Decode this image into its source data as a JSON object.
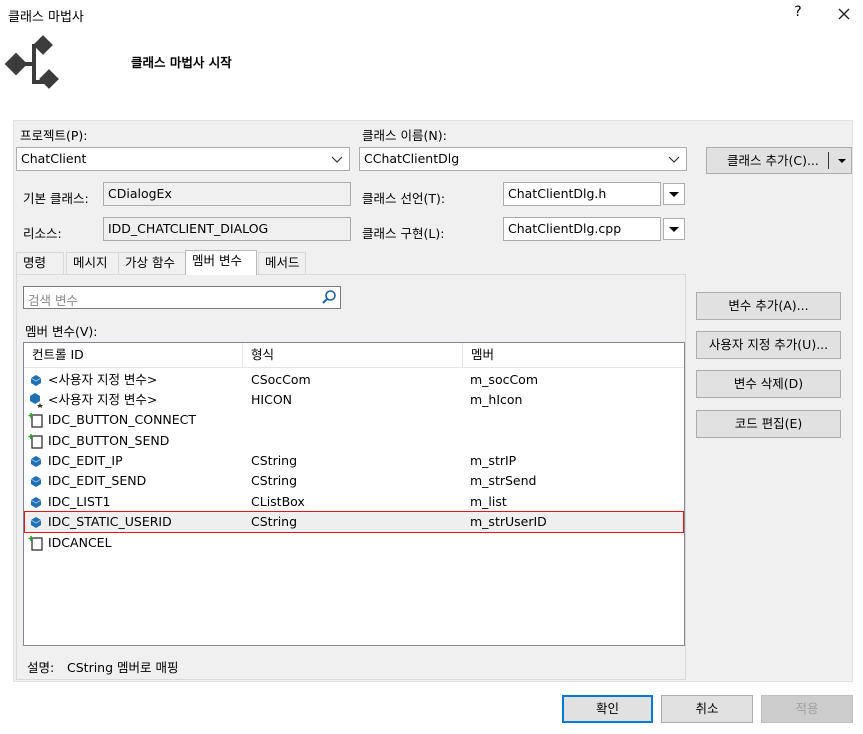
{
  "window": {
    "title": "클래스 마법사",
    "help_label": "?",
    "heading": "클래스 마법사 시작"
  },
  "form": {
    "project_label": "프로젝트(P):",
    "project_value": "ChatClient",
    "class_name_label": "클래스 이름(N):",
    "class_name_value": "CChatClientDlg",
    "add_class_button": "클래스 추가(C)...",
    "base_class_label": "기본 클래스:",
    "base_class_value": "CDialogEx",
    "class_decl_label": "클래스 선언(T):",
    "class_decl_value": "ChatClientDlg.h",
    "resource_label": "리소스:",
    "resource_value": "IDD_CHATCLIENT_DIALOG",
    "class_impl_label": "클래스 구현(L):",
    "class_impl_value": "ChatClientDlg.cpp"
  },
  "tabs": [
    {
      "label": "명령"
    },
    {
      "label": "메시지"
    },
    {
      "label": "가상 함수"
    },
    {
      "label": "멤버 변수",
      "active": true
    },
    {
      "label": "메서드"
    }
  ],
  "search": {
    "placeholder": "검색 변수"
  },
  "member_vars": {
    "section_label": "멤버 변수(V):",
    "columns": [
      "컨트롤 ID",
      "형식",
      "멤버"
    ],
    "rows": [
      {
        "id": "<사용자 지정 변수>",
        "type": "CSocCom",
        "member": "m_socCom",
        "icon": "variable-icon"
      },
      {
        "id": "<사용자 지정 변수>",
        "type": "HICON",
        "member": "m_hIcon",
        "icon": "variable-star-icon"
      },
      {
        "id": "IDC_BUTTON_CONNECT",
        "type": "",
        "member": "",
        "icon": "control-add-icon"
      },
      {
        "id": "IDC_BUTTON_SEND",
        "type": "",
        "member": "",
        "icon": "control-add-icon"
      },
      {
        "id": "IDC_EDIT_IP",
        "type": "CString",
        "member": "m_strIP",
        "icon": "variable-icon"
      },
      {
        "id": "IDC_EDIT_SEND",
        "type": "CString",
        "member": "m_strSend",
        "icon": "variable-icon"
      },
      {
        "id": "IDC_LIST1",
        "type": "CListBox",
        "member": "m_list",
        "icon": "variable-icon"
      },
      {
        "id": "IDC_STATIC_USERID",
        "type": "CString",
        "member": "m_strUserID",
        "icon": "variable-icon",
        "selected": true
      },
      {
        "id": "IDCANCEL",
        "type": "",
        "member": "",
        "icon": "control-add-icon"
      }
    ]
  },
  "description": {
    "label": "설명:",
    "text": "CString 멤버로 매핑"
  },
  "side_buttons": {
    "add_variable": "변수 추가(A)...",
    "add_custom": "사용자 지정 추가(U)...",
    "delete_variable": "변수 삭제(D)",
    "edit_code": "코드 편집(E)"
  },
  "footer": {
    "ok": "확인",
    "cancel": "취소",
    "apply": "적용"
  },
  "colors": {
    "selection_outline": "#e0161d",
    "default_button_border": "#0078d7",
    "variable_icon": "#1f6fb2"
  }
}
